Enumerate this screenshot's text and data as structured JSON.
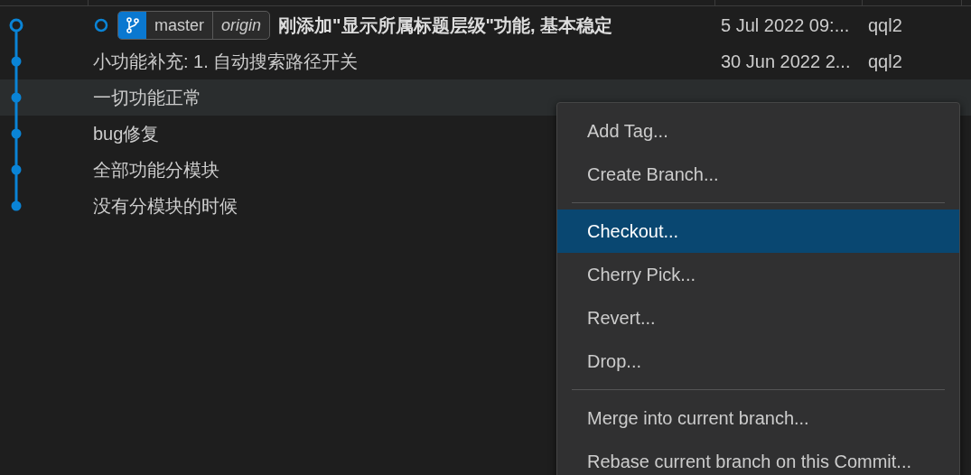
{
  "commits": [
    {
      "message": "刚添加\"显示所属标题层级\"功能, 基本稳定",
      "date": "5 Jul 2022 09:...",
      "author": "qql2",
      "current": true,
      "selected": false,
      "refs": [
        {
          "name": "master",
          "remote": "origin"
        }
      ]
    },
    {
      "message": "小功能补充: 1. 自动搜索路径开关",
      "date": "30 Jun 2022 2...",
      "author": "qql2",
      "current": false,
      "selected": false
    },
    {
      "message": "一切功能正常",
      "current": false,
      "selected": true
    },
    {
      "message": "bug修复",
      "current": false,
      "selected": false
    },
    {
      "message": "全部功能分模块",
      "current": false,
      "selected": false
    },
    {
      "message": "没有分模块的时候",
      "current": false,
      "selected": false
    }
  ],
  "context_menu": {
    "items": [
      {
        "kind": "item",
        "label": "Add Tag...",
        "selected": false
      },
      {
        "kind": "item",
        "label": "Create Branch...",
        "selected": false
      },
      {
        "kind": "separator"
      },
      {
        "kind": "item",
        "label": "Checkout...",
        "selected": true
      },
      {
        "kind": "item",
        "label": "Cherry Pick...",
        "selected": false
      },
      {
        "kind": "item",
        "label": "Revert...",
        "selected": false
      },
      {
        "kind": "item",
        "label": "Drop...",
        "selected": false
      },
      {
        "kind": "separator"
      },
      {
        "kind": "item",
        "label": "Merge into current branch...",
        "selected": false
      },
      {
        "kind": "item",
        "label": "Rebase current branch on this Commit...",
        "selected": false
      }
    ]
  }
}
